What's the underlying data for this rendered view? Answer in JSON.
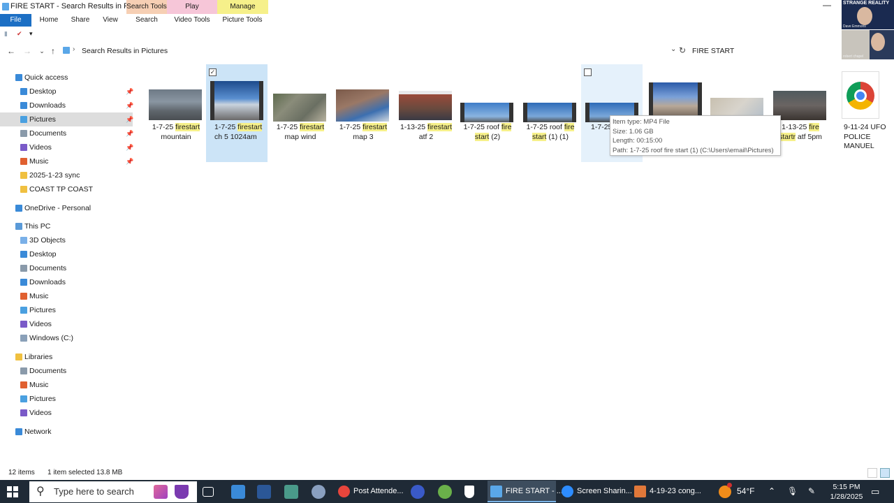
{
  "window": {
    "title": "FIRE START - Search Results in Pictu...",
    "context_tabs": {
      "search_tools": "Search Tools",
      "play": "Play",
      "manage": "Manage"
    },
    "minimize": "—"
  },
  "ribbon": {
    "tabs": [
      "File",
      "Home",
      "Share",
      "View",
      "Search",
      "Video Tools",
      "Picture Tools"
    ]
  },
  "address": {
    "path": "Search Results in Pictures",
    "search_value": "FIRE START"
  },
  "nav": {
    "quick_access": "Quick access",
    "quick_items": [
      {
        "label": "Desktop",
        "pinned": true
      },
      {
        "label": "Downloads",
        "pinned": true
      },
      {
        "label": "Pictures",
        "pinned": true
      },
      {
        "label": "Documents",
        "pinned": true
      },
      {
        "label": "Videos",
        "pinned": true
      },
      {
        "label": "Music",
        "pinned": true
      },
      {
        "label": "2025-1-23  sync",
        "pinned": false
      },
      {
        "label": "COAST TP COAST",
        "pinned": false
      }
    ],
    "onedrive": "OneDrive - Personal",
    "this_pc": "This PC",
    "pc_items": [
      "3D Objects",
      "Desktop",
      "Documents",
      "Downloads",
      "Music",
      "Pictures",
      "Videos",
      "Windows (C:)"
    ],
    "libraries": "Libraries",
    "lib_items": [
      "Documents",
      "Music",
      "Pictures",
      "Videos"
    ],
    "network": "Network",
    "pin_glyph": "📌"
  },
  "files": [
    {
      "pre": "1-7-25 ",
      "hl1": "fire",
      "mid": "",
      "hl2": "start",
      "post": " mountain"
    },
    {
      "pre": "1-7-25 ",
      "hl1": "fire",
      "mid": "",
      "hl2": "start",
      "post": " ch 5 1024am"
    },
    {
      "pre": "1-7-25 ",
      "hl1": "fire",
      "mid": "",
      "hl2": "start",
      "post": " map wind"
    },
    {
      "pre": "1-7-25 ",
      "hl1": "fire",
      "mid": "",
      "hl2": "start",
      "post": " map 3"
    },
    {
      "pre": "1-13-25 ",
      "hl1": "fire",
      "mid": "",
      "hl2": "start",
      "post": " atf 2"
    },
    {
      "pre": "1-7-25 roof ",
      "hl1": "fire",
      "mid": " ",
      "hl2": "start",
      "post": " (2)"
    },
    {
      "pre": "1-7-25 roof ",
      "hl1": "fire",
      "mid": " ",
      "hl2": "start",
      "post": " (1) (1)"
    },
    {
      "pre": "1-7-25 ",
      "hl1": "fire",
      "mid": "",
      "hl2": "sta",
      "post": ""
    },
    {
      "pre": "",
      "hl1": "",
      "mid": "",
      "hl2": "",
      "post": ""
    },
    {
      "pre": "",
      "hl1": "",
      "mid": "",
      "hl2": "",
      "post": ""
    },
    {
      "pre": "1-13-25 ",
      "hl1": "fire",
      "mid": " ",
      "hl2": "startr",
      "post": " atf 5pm"
    },
    {
      "pre": "9-11-24 UFO POLICE MANUEL",
      "hl1": "",
      "mid": "",
      "hl2": "",
      "post": ""
    }
  ],
  "checkbox_checked": "✓",
  "tooltip": {
    "type": "Item type: MP4 File",
    "size": "Size: 1.06 GB",
    "length": "Length: 00:15:00",
    "path": "Path: 1-7-25 roof fire start (1) (C:\\Users\\email\\Pictures)"
  },
  "status": {
    "count": "12 items",
    "selected": "1 item selected  13.8 MB"
  },
  "taskbar": {
    "search_placeholder": "Type here to search",
    "apps": [
      {
        "label": "Post Attende...",
        "color": "#e8453c"
      },
      {
        "label": "FIRE START - ...",
        "color": "#5aa7e8"
      },
      {
        "label": "Screen Sharin...",
        "color": "#2d8cff"
      },
      {
        "label": "4-19-23 cong...",
        "color": "#e0783a"
      }
    ],
    "weather": "54°F",
    "time": "5:15 PM",
    "date": "1/28/2025"
  },
  "webcam": {
    "title": "STRANGE REALITY",
    "name1": "Dave Emmons",
    "name2": "robert chapel"
  },
  "colors": {
    "accent": "#1c6fc4",
    "selection": "#cce4f7",
    "highlight": "#f6f08a"
  }
}
